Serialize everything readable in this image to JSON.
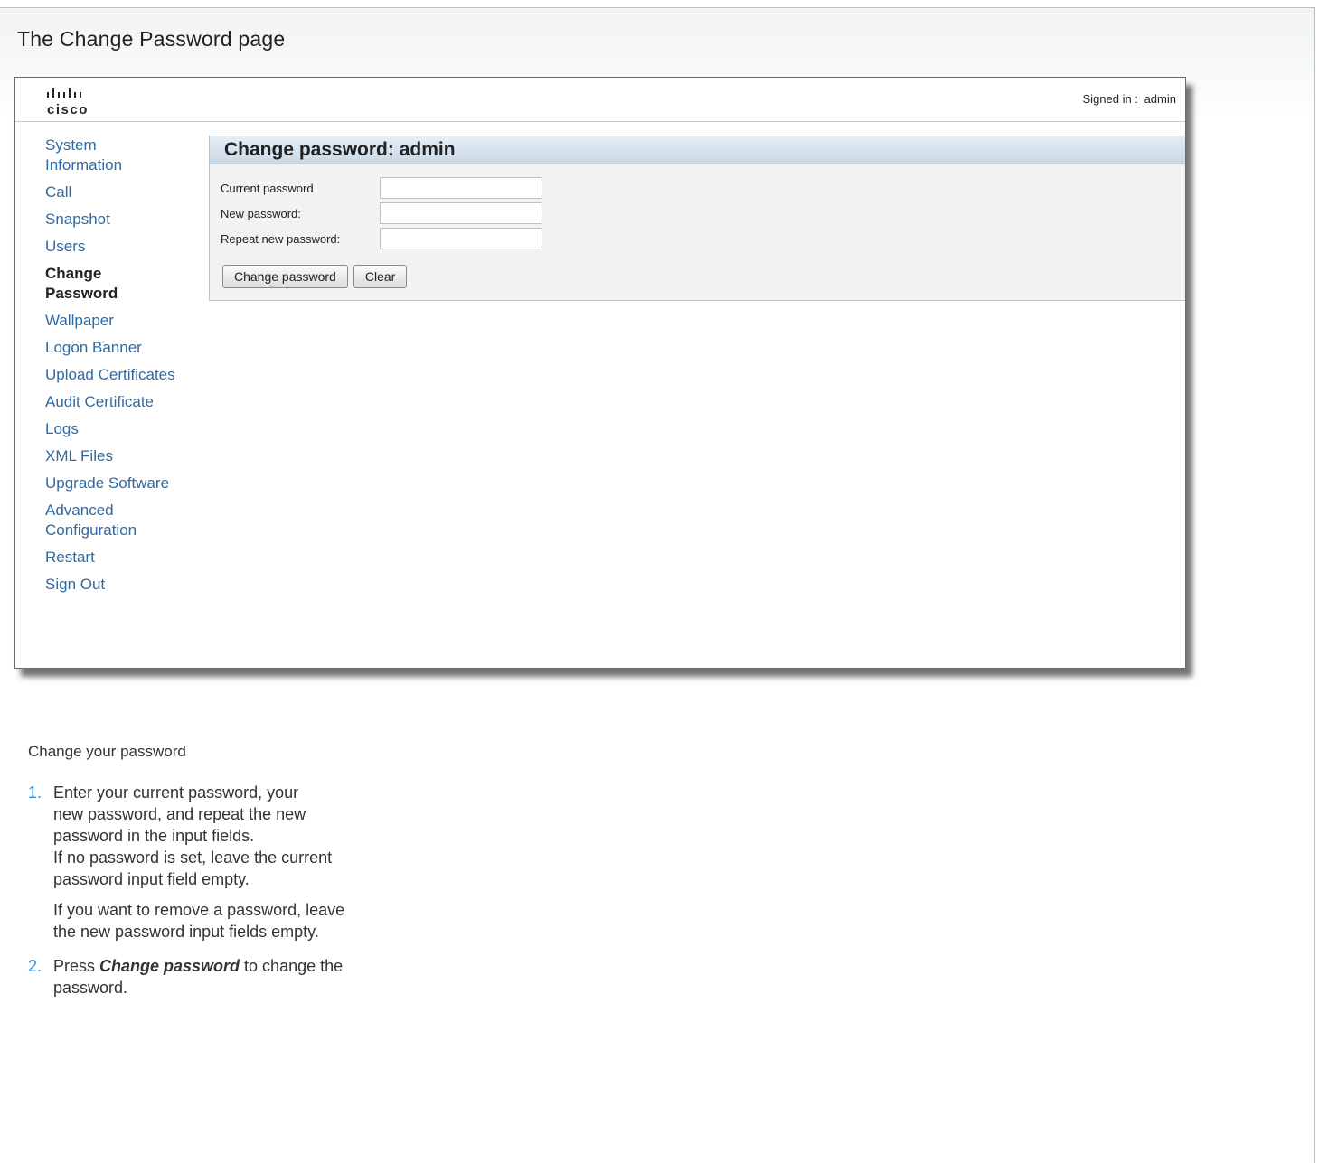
{
  "document": {
    "title": "The Change Password page"
  },
  "screenshot": {
    "logo": {
      "wordmark": "cisco",
      "icon": "cisco-bridge-logo"
    },
    "signed_in": {
      "label": "Signed in :",
      "user": "admin"
    },
    "nav": {
      "items": [
        {
          "label": "System Information",
          "active": false
        },
        {
          "label": "Call",
          "active": false
        },
        {
          "label": "Snapshot",
          "active": false
        },
        {
          "label": "Users",
          "active": false
        },
        {
          "label": "Change Password",
          "active": true
        },
        {
          "label": "Wallpaper",
          "active": false
        },
        {
          "label": "Logon Banner",
          "active": false
        },
        {
          "label": "Upload Certificates",
          "active": false
        },
        {
          "label": "Audit Certificate",
          "active": false
        },
        {
          "label": "Logs",
          "active": false
        },
        {
          "label": "XML Files",
          "active": false
        },
        {
          "label": "Upgrade Software",
          "active": false
        },
        {
          "label": "Advanced Configuration",
          "active": false
        },
        {
          "label": "Restart",
          "active": false
        },
        {
          "label": "Sign Out",
          "active": false
        }
      ]
    },
    "panel": {
      "title": "Change password: admin",
      "fields": {
        "current": {
          "label": "Current password",
          "value": ""
        },
        "new": {
          "label": "New password:",
          "value": ""
        },
        "repeat": {
          "label": "Repeat new password:",
          "value": ""
        }
      },
      "buttons": {
        "change": "Change password",
        "clear": "Clear"
      }
    },
    "colors": {
      "link": "#2f6aa5",
      "panel_header": "#c9d8e6"
    }
  },
  "instructions": {
    "heading": "Change your password",
    "steps": [
      {
        "num": "1.",
        "lines": [
          "Enter your current password, your",
          "new password, and repeat the new",
          "password in the input fields.",
          "If no password is set, leave the current",
          "password input field empty."
        ],
        "extra_lines": [
          "If you want to remove a password, leave",
          "the new password input fields empty."
        ]
      },
      {
        "num": "2.",
        "prefix": "Press ",
        "emphasis": "Change password",
        "suffix": " to change the",
        "line2": "password."
      }
    ],
    "number_color": "#3e8fcf"
  }
}
